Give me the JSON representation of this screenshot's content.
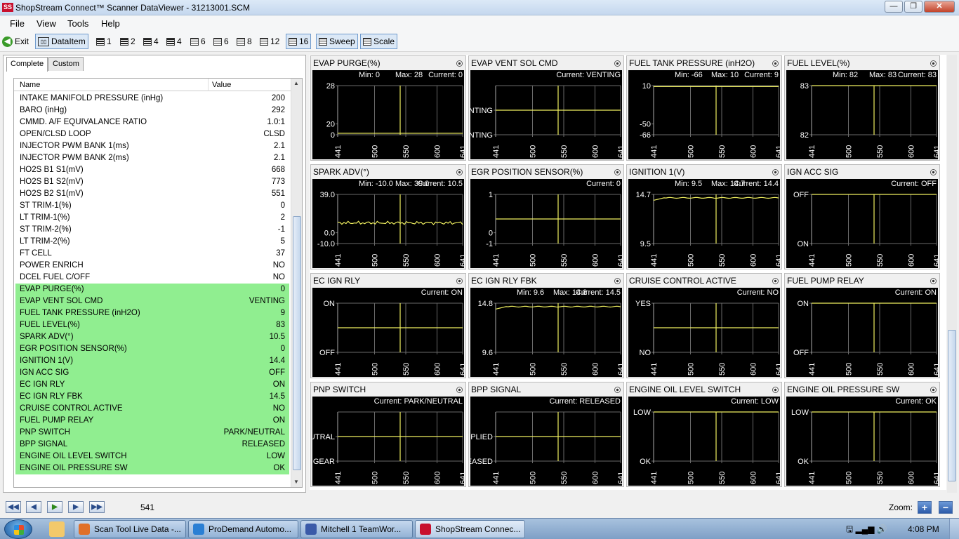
{
  "window": {
    "title": "ShopStream Connect™ Scanner DataViewer - 31213001.SCM",
    "logo_text": "SS",
    "minimize_icon": "minimize-icon",
    "maximize_icon": "maximize-icon",
    "close_icon": "close-icon"
  },
  "menu": [
    "File",
    "View",
    "Tools",
    "Help"
  ],
  "toolbar": {
    "exit": "Exit",
    "dataitem": "DataItem",
    "layouts": [
      "1",
      "2",
      "4",
      "4",
      "6",
      "6",
      "8",
      "12",
      "16"
    ],
    "sweep": "Sweep",
    "scale": "Scale"
  },
  "tabs": [
    "Complete",
    "Custom"
  ],
  "table": {
    "col_name": "Name",
    "col_value": "Value",
    "rows": [
      {
        "name": "INTAKE MANIFOLD PRESSURE (inHg)",
        "value": "200",
        "hl": false
      },
      {
        "name": "BARO (inHg)",
        "value": "292",
        "hl": false
      },
      {
        "name": "CMMD. A/F EQUIVALANCE RATIO",
        "value": "1.0:1",
        "hl": false
      },
      {
        "name": "OPEN/CLSD LOOP",
        "value": "CLSD",
        "hl": false
      },
      {
        "name": "INJECTOR PWM BANK 1(ms)",
        "value": "2.1",
        "hl": false
      },
      {
        "name": "INJECTOR PWM BANK 2(ms)",
        "value": "2.1",
        "hl": false
      },
      {
        "name": "HO2S B1 S1(mV)",
        "value": "668",
        "hl": false
      },
      {
        "name": "HO2S B1 S2(mV)",
        "value": "773",
        "hl": false
      },
      {
        "name": "HO2S B2 S1(mV)",
        "value": "551",
        "hl": false
      },
      {
        "name": "ST TRIM-1(%)",
        "value": "0",
        "hl": false
      },
      {
        "name": "LT TRIM-1(%)",
        "value": "2",
        "hl": false
      },
      {
        "name": "ST TRIM-2(%)",
        "value": "-1",
        "hl": false
      },
      {
        "name": "LT TRIM-2(%)",
        "value": "5",
        "hl": false
      },
      {
        "name": "FT CELL",
        "value": "37",
        "hl": false
      },
      {
        "name": "POWER ENRICH",
        "value": "NO",
        "hl": false
      },
      {
        "name": "DCEL FUEL C/OFF",
        "value": "NO",
        "hl": false
      },
      {
        "name": "EVAP PURGE(%)",
        "value": "0",
        "hl": true
      },
      {
        "name": "EVAP VENT SOL CMD",
        "value": "VENTING",
        "hl": true
      },
      {
        "name": "FUEL TANK PRESSURE  (inH2O)",
        "value": "9",
        "hl": true
      },
      {
        "name": "FUEL LEVEL(%)",
        "value": "83",
        "hl": true
      },
      {
        "name": "SPARK ADV(°)",
        "value": "10.5",
        "hl": true
      },
      {
        "name": "EGR POSITION SENSOR(%)",
        "value": "0",
        "hl": true
      },
      {
        "name": "IGNITION 1(V)",
        "value": "14.4",
        "hl": true
      },
      {
        "name": "IGN ACC SIG",
        "value": "OFF",
        "hl": true
      },
      {
        "name": "EC IGN RLY",
        "value": "ON",
        "hl": true
      },
      {
        "name": "EC IGN RLY FBK",
        "value": "14.5",
        "hl": true
      },
      {
        "name": "CRUISE CONTROL ACTIVE",
        "value": "NO",
        "hl": true
      },
      {
        "name": "FUEL PUMP RELAY",
        "value": "ON",
        "hl": true
      },
      {
        "name": "PNP SWITCH",
        "value": "PARK/NEUTRAL",
        "hl": true
      },
      {
        "name": "BPP SIGNAL",
        "value": "RELEASED",
        "hl": true
      },
      {
        "name": "ENGINE OIL LEVEL SWITCH",
        "value": "LOW",
        "hl": true
      },
      {
        "name": "ENGINE OIL PRESSURE SW",
        "value": "OK",
        "hl": true
      }
    ]
  },
  "x_ticks": [
    "441",
    "500",
    "550",
    "600",
    "641"
  ],
  "cursor_frame": 541,
  "colors": {
    "trace": "#f0f060",
    "grid": "#6a6a6a",
    "highlight": "#90ee90",
    "graph_bg": "#000000"
  },
  "panels": [
    {
      "title": "EVAP PURGE(%)",
      "min": "Min: 0",
      "max": "Max: 28",
      "current": "Current: 0",
      "ylabels": [
        "28",
        "20",
        "0"
      ],
      "trace": "flat",
      "level": 0.03
    },
    {
      "title": "EVAP VENT SOL CMD",
      "current": "Current: VENTING",
      "ylabels": [
        "VENTING",
        "NOT VENTING"
      ],
      "trace": "flat",
      "level": 0.5
    },
    {
      "title": "FUEL TANK PRESSURE  (inH2O)",
      "min": "Min: -66",
      "max": "Max: 10",
      "current": "Current: 9",
      "ylabels": [
        "10",
        "-50",
        "-66"
      ],
      "trace": "flat",
      "level": 0.98
    },
    {
      "title": "FUEL LEVEL(%)",
      "min": "Min: 82",
      "max": "Max: 83",
      "current": "Current: 83",
      "ylabels": [
        "83",
        "82"
      ],
      "trace": "flat",
      "level": 1.0
    },
    {
      "title": "SPARK ADV(°)",
      "min": "Min: -10.0",
      "max": "Max: 39.0",
      "current": "Current: 10.5",
      "ylabels": [
        "39.0",
        "0.0",
        "-10.0"
      ],
      "trace": "noisy",
      "level": 0.42
    },
    {
      "title": "EGR POSITION SENSOR(%)",
      "current": "Current: 0",
      "ylabels": [
        "1",
        "0",
        "-1"
      ],
      "trace": "flat",
      "level": 0.5
    },
    {
      "title": "IGNITION 1(V)",
      "min": "Min: 9.5",
      "max": "Max: 14.7",
      "current": "Current: 14.4",
      "ylabels": [
        "14.7",
        "9.5"
      ],
      "trace": "rising",
      "level": 0.95
    },
    {
      "title": "IGN ACC SIG",
      "current": "Current: OFF",
      "ylabels": [
        "OFF",
        "ON"
      ],
      "trace": "flat",
      "level": 1.0
    },
    {
      "title": "EC IGN RLY",
      "current": "Current: ON",
      "ylabels": [
        "ON",
        "OFF"
      ],
      "trace": "flat",
      "level": 0.5
    },
    {
      "title": "EC IGN RLY FBK",
      "min": "Min: 9.6",
      "max": "Max: 14.8",
      "current": "Current: 14.5",
      "ylabels": [
        "14.8",
        "9.6"
      ],
      "trace": "rising",
      "level": 0.95
    },
    {
      "title": "CRUISE CONTROL ACTIVE",
      "current": "Current: NO",
      "ylabels": [
        "YES",
        "NO"
      ],
      "trace": "flat",
      "level": 0.5
    },
    {
      "title": "FUEL PUMP RELAY",
      "current": "Current: ON",
      "ylabels": [
        "ON",
        "OFF"
      ],
      "trace": "flat",
      "level": 1.0
    },
    {
      "title": "PNP SWITCH",
      "current": "Current: PARK/NEUTRAL",
      "ylabels": [
        "PARK/NEUTRAL",
        "IN GEAR"
      ],
      "trace": "flat",
      "level": 0.5
    },
    {
      "title": "BPP SIGNAL",
      "current": "Current: RELEASED",
      "ylabels": [
        "APPLIED",
        "RELEASED"
      ],
      "trace": "flat",
      "level": 0.5
    },
    {
      "title": "ENGINE OIL LEVEL SWITCH",
      "current": "Current: LOW",
      "ylabels": [
        "LOW",
        "OK"
      ],
      "trace": "flat",
      "level": 1.0
    },
    {
      "title": "ENGINE OIL PRESSURE SW",
      "current": "Current: OK",
      "ylabels": [
        "LOW",
        "OK"
      ],
      "trace": "flat",
      "level": 1.0
    }
  ],
  "playback": {
    "buttons": [
      "first-frame-icon",
      "prev-frame-icon",
      "play-icon",
      "next-frame-icon",
      "last-frame-icon"
    ],
    "frame": "541",
    "zoom_label": "Zoom:",
    "zoom_in": "+",
    "zoom_out": "−"
  },
  "taskbar": {
    "tasks": [
      {
        "label": "Scan Tool Live Data -...",
        "color": "#e0702a",
        "active": false
      },
      {
        "label": "ProDemand Automo...",
        "color": "#2a7fd4",
        "active": false
      },
      {
        "label": "Mitchell 1 TeamWor...",
        "color": "#3a5aa8",
        "active": false
      },
      {
        "label": "ShopStream Connec...",
        "color": "#c8102e",
        "active": true
      }
    ],
    "time": "4:08 PM"
  }
}
